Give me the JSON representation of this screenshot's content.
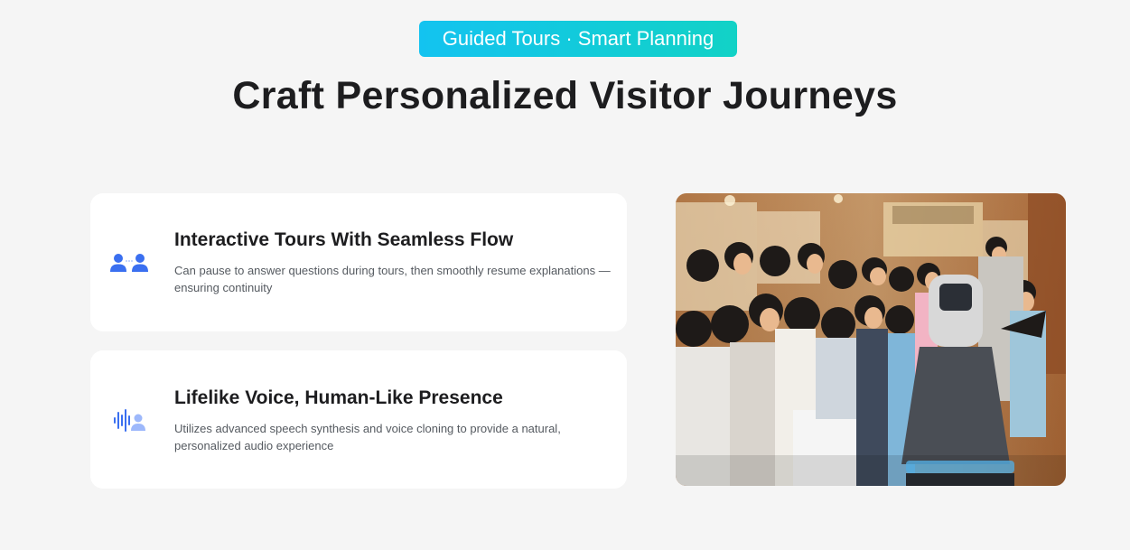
{
  "header": {
    "badge": "Guided Tours · Smart Planning",
    "title": "Craft Personalized Visitor Journeys"
  },
  "features": [
    {
      "icon": "users-icon",
      "title": "Interactive Tours With Seamless Flow",
      "description": "Can pause to answer questions during tours, then smoothly resume explanations —ensuring continuity"
    },
    {
      "icon": "voice-wave-icon",
      "title": "Lifelike Voice, Human-Like Presence",
      "description": "Utilizes advanced speech synthesis and voice cloning to provide a natural, personalized audio experience"
    }
  ],
  "photo": {
    "subject": "museum-tour-photo"
  },
  "colors": {
    "background": "#f5f5f5",
    "badge_gradient_start": "#13c3f0",
    "badge_gradient_end": "#12d2c6",
    "icon_blue": "#3a6ff0",
    "icon_light_blue": "#9db8fb",
    "title_text": "#1d1d1f",
    "body_text": "#555a60"
  }
}
